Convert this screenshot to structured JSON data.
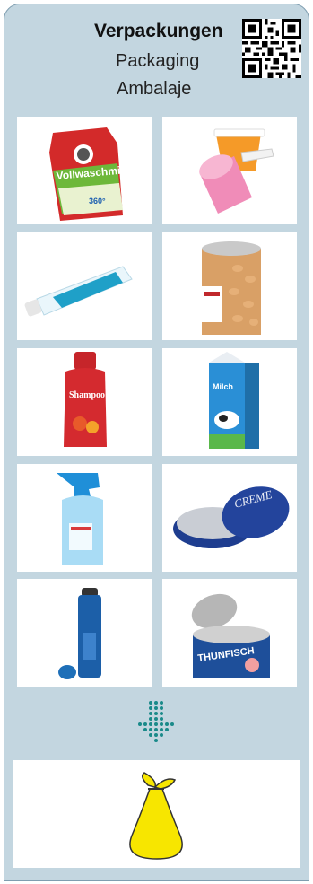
{
  "header": {
    "title_de": "Verpackungen",
    "title_en": "Packaging",
    "title_ro": "Ambalaje"
  },
  "items": [
    {
      "name": "detergent-bag-image",
      "label": "Vollwaschmittel",
      "sublabel": "360°"
    },
    {
      "name": "yogurt-cups-image"
    },
    {
      "name": "toothpaste-tube-image"
    },
    {
      "name": "baked-beans-can-image"
    },
    {
      "name": "shampoo-bottle-image",
      "label": "Shampoo"
    },
    {
      "name": "milk-carton-image",
      "label": "Milch"
    },
    {
      "name": "spray-bottle-image"
    },
    {
      "name": "creme-tin-image",
      "label": "CREME"
    },
    {
      "name": "deodorant-spray-can-image"
    },
    {
      "name": "tuna-can-image",
      "label": "THUNFISCH"
    }
  ],
  "result": {
    "name": "yellow-bag-image"
  },
  "colors": {
    "panel": "#c3d6e0",
    "border": "#7f9eb0",
    "arrow": "#1a8a8a",
    "bag": "#f7e600"
  }
}
